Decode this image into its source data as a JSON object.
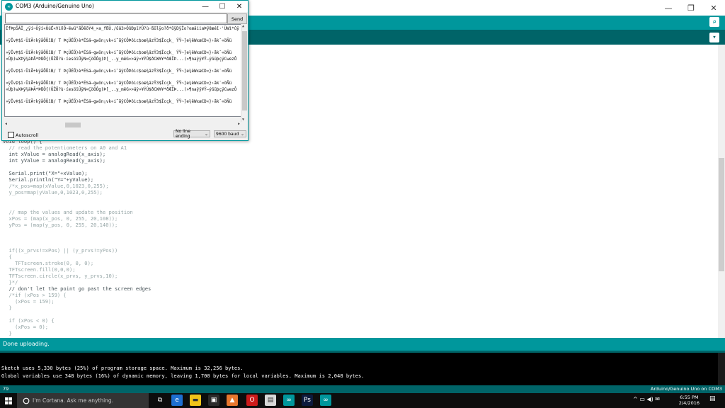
{
  "ide": {
    "window_controls": {
      "minimize": "—",
      "maximize": "❐",
      "close": "✕"
    },
    "code_lines": [
      {
        "text": "void loop() {",
        "cls": ""
      },
      {
        "text": "  // read the potentiometers on A0 and A1",
        "cls": "cm"
      },
      {
        "text": "  int xValue = analogRead(x_axis);",
        "cls": ""
      },
      {
        "text": "  int yValue = analogRead(y_axis);",
        "cls": ""
      },
      {
        "text": "",
        "cls": ""
      },
      {
        "text": "  Serial.print(\"X=\"+xValue);",
        "cls": ""
      },
      {
        "text": "  Serial.println(\"Y=\"+yValue);",
        "cls": ""
      },
      {
        "text": "  /*x_pos=map(xValue,0,1023,0,255);",
        "cls": "cm"
      },
      {
        "text": "  y_pos=map(yValue,0,1023,0,255);",
        "cls": "cm"
      },
      {
        "text": "",
        "cls": ""
      },
      {
        "text": "",
        "cls": ""
      },
      {
        "text": "  // map the values and update the position",
        "cls": "cm"
      },
      {
        "text": "  xPos = (map(x_pos, 0, 255, 20,108));",
        "cls": "cm"
      },
      {
        "text": "  yPos = (map(y_pos, 0, 255, 20,140));",
        "cls": "cm"
      },
      {
        "text": "",
        "cls": ""
      },
      {
        "text": "",
        "cls": ""
      },
      {
        "text": "",
        "cls": ""
      },
      {
        "text": "  if((x_prvs!=xPos) || (y_prvs!=yPos))",
        "cls": "cm"
      },
      {
        "text": "  {",
        "cls": "cm"
      },
      {
        "text": "    TFTscreen.stroke(0, 0, 0);",
        "cls": "cm"
      },
      {
        "text": "  TFTscreen.fill(0,0,0);",
        "cls": "cm"
      },
      {
        "text": "  TFTscreen.circle(x_prvs, y_prvs,10);",
        "cls": "cm"
      },
      {
        "text": "  }*/",
        "cls": "cm"
      },
      {
        "text": "  // don't let the point go past the screen edges",
        "cls": ""
      },
      {
        "text": "  /*if (xPos > 159) {",
        "cls": "cm"
      },
      {
        "text": "    (xPos = 159);",
        "cls": "cm"
      },
      {
        "text": "  }",
        "cls": "cm"
      },
      {
        "text": "",
        "cls": ""
      },
      {
        "text": "  if (xPos < 0) {",
        "cls": "cm"
      },
      {
        "text": "    (xPos = 0);",
        "cls": "cm"
      },
      {
        "text": "  }",
        "cls": "cm"
      }
    ],
    "status_message": "Done uploading.",
    "console_lines": [
      "Sketch uses 5,330 bytes (25%) of program storage space. Maximum is 32,256 bytes.",
      "Global variables use 348 bytes (16%) of dynamic memory, leaving 1,700 bytes for local variables. Maximum is 2,048 bytes."
    ],
    "line_number": "79",
    "board_status": "Arduino/Genuino Uno on COM3"
  },
  "serial_monitor": {
    "title": "COM3 (Arduino/Genuino Uno)",
    "input_value": "",
    "send_label": "Send",
    "output_lines": [
      "ÉfÞpŠÃÎ_¿ÿí~Ûÿí«ÜúË«ViñÕ~ëwü\"ãÖêôÝ4_×a_fßÜ./ûâ3>ÖûÐpïYÛ?ù·ßûlÿo?ð*ûÿDÿÏo?oæäiiaÞÿ8æéî·'ÜWì*ûÿ",
      "",
      "»ÿÎv‡$ï·ÜïÃ÷kÿåÕÜïB/ T ÞçÜÉÕ)è*ÉSä—gwôn¡vk«i˜ãÿCÕÞöic$oæ¾äzŸ3$Îcçk_ ŸŸ~]e¾êWxæCD«}›ãk¯«öÑü",
      "",
      "»ÿÎv‡$ï·ÜïÃ÷kÿåÕÜïB/ T ÞçÜÉÕ)è*ÉSä—gwôn¡vk«i˜ãÿCÕÞöic$oæ¾äzŸ3$Îcçk_ ŸŸ~]e¾êWxæCD«}›ãk¯«öÑü",
      "«Ùþ)wXÞÿ¾äÞÃ*ÞßÖ{(ÜŽÕ?ù·íesöïÛÿN«ÇöÓÓg)Þ[_..y_mëG»>äÿ»¥ÝÙ$ðCW¥¥*ðÆÏÞ...(»¶naÿÿ¥Ÿ—ýGüþçÿCwezÔ",
      "",
      "»ÿÎv‡$ï·ÜïÃ÷kÿåÕÜïB/ T ÞçÜÉÕ)è*ÉSä—gwôn¡vk«i˜ãÿCÕÞöic$oæ¾äzŸ3$Îcçk_ ŸŸ~]e¾êWxæCD«}›ãk¯«öÑü",
      "",
      "»ÿÎv‡$ï·ÜïÃ÷kÿåÕÜïB/ T ÞçÜÉÕ)è*ÉSä—gwôn¡vk«i˜ãÿCÕÞöic$oæ¾äzŸ3$Îcçk_ ŸŸ~]e¾êWxæCD«}›ãk¯«öÑü",
      "«Ùþ)wXÞÿ¾äÞÃ*ÞßÖ{(ÜŽÕ?ù·íesöïÛÿN«ÇöÓÓg)Þ[_..y_mëG»>äÿ»¥ÝÙ$ðCW¥¥*ðÆÏÞ...(»¶naÿÿ¥Ÿ—ýGüþçÿCwezÔ",
      "",
      "»ÿÎv‡$ï·ÜïÃ÷kÿåÕÜïB/ T ÞçÜÉÕ)è*ÉSä—gwôn¡vk«i˜ãÿCÕÞöic$oæ¾äzŸ3$Îcçk_ ŸŸ~]e¾êWxæCD«}›ãk¯«öÑü"
    ],
    "autoscroll_label": "Autoscroll",
    "autoscroll_checked": false,
    "line_ending": "No line ending",
    "baud_rate": "9600 baud",
    "window_controls": {
      "minimize": "—",
      "maximize": "☐",
      "close": "✕"
    }
  },
  "taskbar": {
    "cortana_placeholder": "I'm Cortana. Ask me anything.",
    "time": "6:55 PM",
    "date": "2/4/2016",
    "apps": [
      {
        "name": "task-view-icon",
        "glyph": "⧉",
        "color": "#0d0d0d"
      },
      {
        "name": "edge-icon",
        "glyph": "e",
        "color": "#1e6fd0"
      },
      {
        "name": "file-explorer-icon",
        "glyph": "▬",
        "color": "#f0c419"
      },
      {
        "name": "store-icon",
        "glyph": "▣",
        "color": "#2b2b2b"
      },
      {
        "name": "vlc-icon",
        "glyph": "▲",
        "color": "#e8772e"
      },
      {
        "name": "opera-icon",
        "glyph": "O",
        "color": "#cc1b1b"
      },
      {
        "name": "notepad-icon",
        "glyph": "▤",
        "color": "#d8d8d8"
      },
      {
        "name": "arduino-icon",
        "glyph": "∞",
        "color": "#00979c"
      },
      {
        "name": "photoshop-icon",
        "glyph": "Ps",
        "color": "#0c1a3d"
      },
      {
        "name": "arduino-active-icon",
        "glyph": "∞",
        "color": "#00979c"
      }
    ]
  }
}
